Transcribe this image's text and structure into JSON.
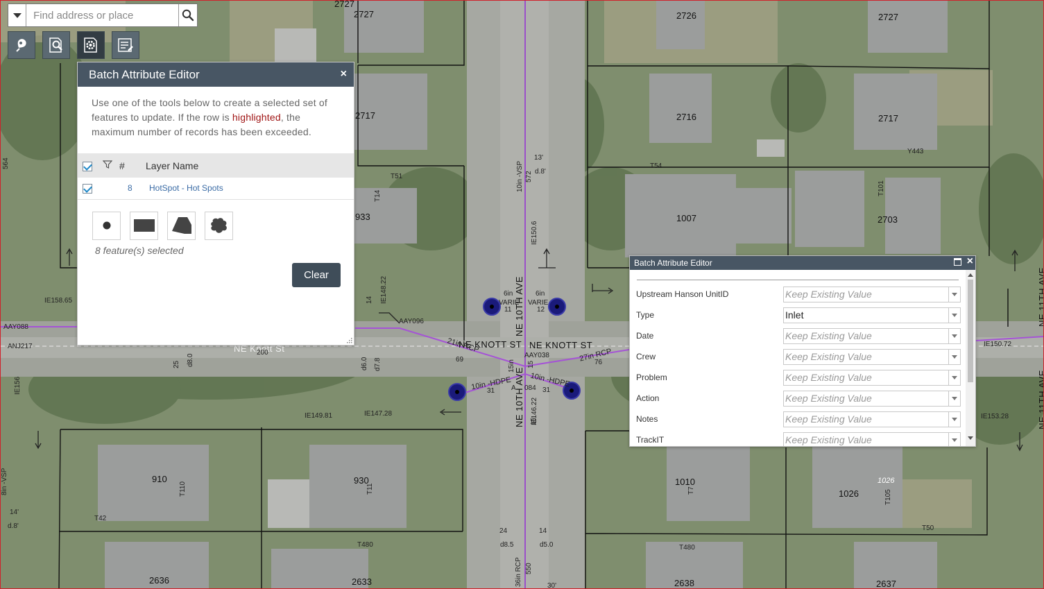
{
  "search": {
    "placeholder": "Find address or place"
  },
  "toolbar": {
    "buttons": [
      {
        "name": "location-tool",
        "icon": "pin-marker-icon"
      },
      {
        "name": "search-tool",
        "icon": "magnify-doc-icon"
      },
      {
        "name": "batch-editor-tool",
        "icon": "gear-doc-icon",
        "active": true
      },
      {
        "name": "list-tool",
        "icon": "list-edit-icon"
      }
    ]
  },
  "batch_panel": {
    "title": "Batch Attribute Editor",
    "close_label": "×",
    "intro_before": "Use one of the tools below to create a selected set of features to update. If the row is ",
    "intro_highlight": "highlighted",
    "intro_after": ", the maximum number of records has been exceeded.",
    "table": {
      "headers": {
        "count": "#",
        "layer": "Layer Name"
      },
      "rows": [
        {
          "count": "8",
          "layer": "HotSpot - Hot Spots"
        }
      ]
    },
    "tools": [
      "select-point-icon",
      "select-rectangle-icon",
      "select-polygon-icon",
      "select-freehand-icon"
    ],
    "selection_text": "8 feature(s) selected",
    "clear_label": "Clear"
  },
  "attr_popup": {
    "title": "Batch Attribute Editor",
    "fields": [
      {
        "label": "Upstream Hanson UnitID",
        "value": "Keep Existing Value",
        "placeholder": true
      },
      {
        "label": "Type",
        "value": "Inlet",
        "placeholder": false
      },
      {
        "label": "Date",
        "value": "Keep Existing Value",
        "placeholder": true
      },
      {
        "label": "Crew",
        "value": "Keep Existing Value",
        "placeholder": true
      },
      {
        "label": "Problem",
        "value": "Keep Existing Value",
        "placeholder": true
      },
      {
        "label": "Action",
        "value": "Keep Existing Value",
        "placeholder": true
      },
      {
        "label": "Notes",
        "value": "Keep Existing Value",
        "placeholder": true
      },
      {
        "label": "TrackIT",
        "value": "Keep Existing Value",
        "placeholder": true
      }
    ]
  },
  "map": {
    "parcels": [
      "2727",
      "2727",
      "2726",
      "2727",
      "2717",
      "2716",
      "2717",
      "1007",
      "2703",
      "933",
      "910",
      "930",
      "1010",
      "1026",
      "1026",
      "2636",
      "2633",
      "2638",
      "2637"
    ],
    "streets": [
      "NE Knott St",
      "NE KNOTT ST",
      "NE KNOTT ST",
      "NE 10TH AVE",
      "NE 10TH AVE",
      "NE 11TH AVE",
      "NE 11TH AVE"
    ],
    "labels": [
      "Y443",
      "T54",
      "T51",
      "T14",
      "T101",
      "IE158.65",
      "AAY088",
      "AAY096",
      "AAY038",
      "ANJ217",
      "IE150.72",
      "IE153.28",
      "IE149.81",
      "IE147.28",
      "T42",
      "T110",
      "T11",
      "T7",
      "T105",
      "T480",
      "T480",
      "T50",
      "d.8'",
      "14'",
      "13'",
      "d.8'",
      "10in -VSP",
      "572",
      "IE150.6",
      "IE148.22",
      "d7.8",
      "d8.0",
      "d8.5",
      "d5.0",
      "d6.0",
      "25",
      "24",
      "14",
      "14",
      "11",
      "15",
      "15",
      "12",
      "6in",
      "6in",
      "VARIE",
      "VARIE",
      "21in RCP",
      "27in RCP",
      "10in -HDPE",
      "10in -HDPE",
      "31",
      "31",
      "69",
      "76",
      "084",
      "15in",
      "200",
      "550",
      "30'",
      "36in RCP",
      "A",
      "564",
      "IE156",
      "8in -VSP",
      "IE146.22"
    ],
    "hotspot_count": 4
  }
}
